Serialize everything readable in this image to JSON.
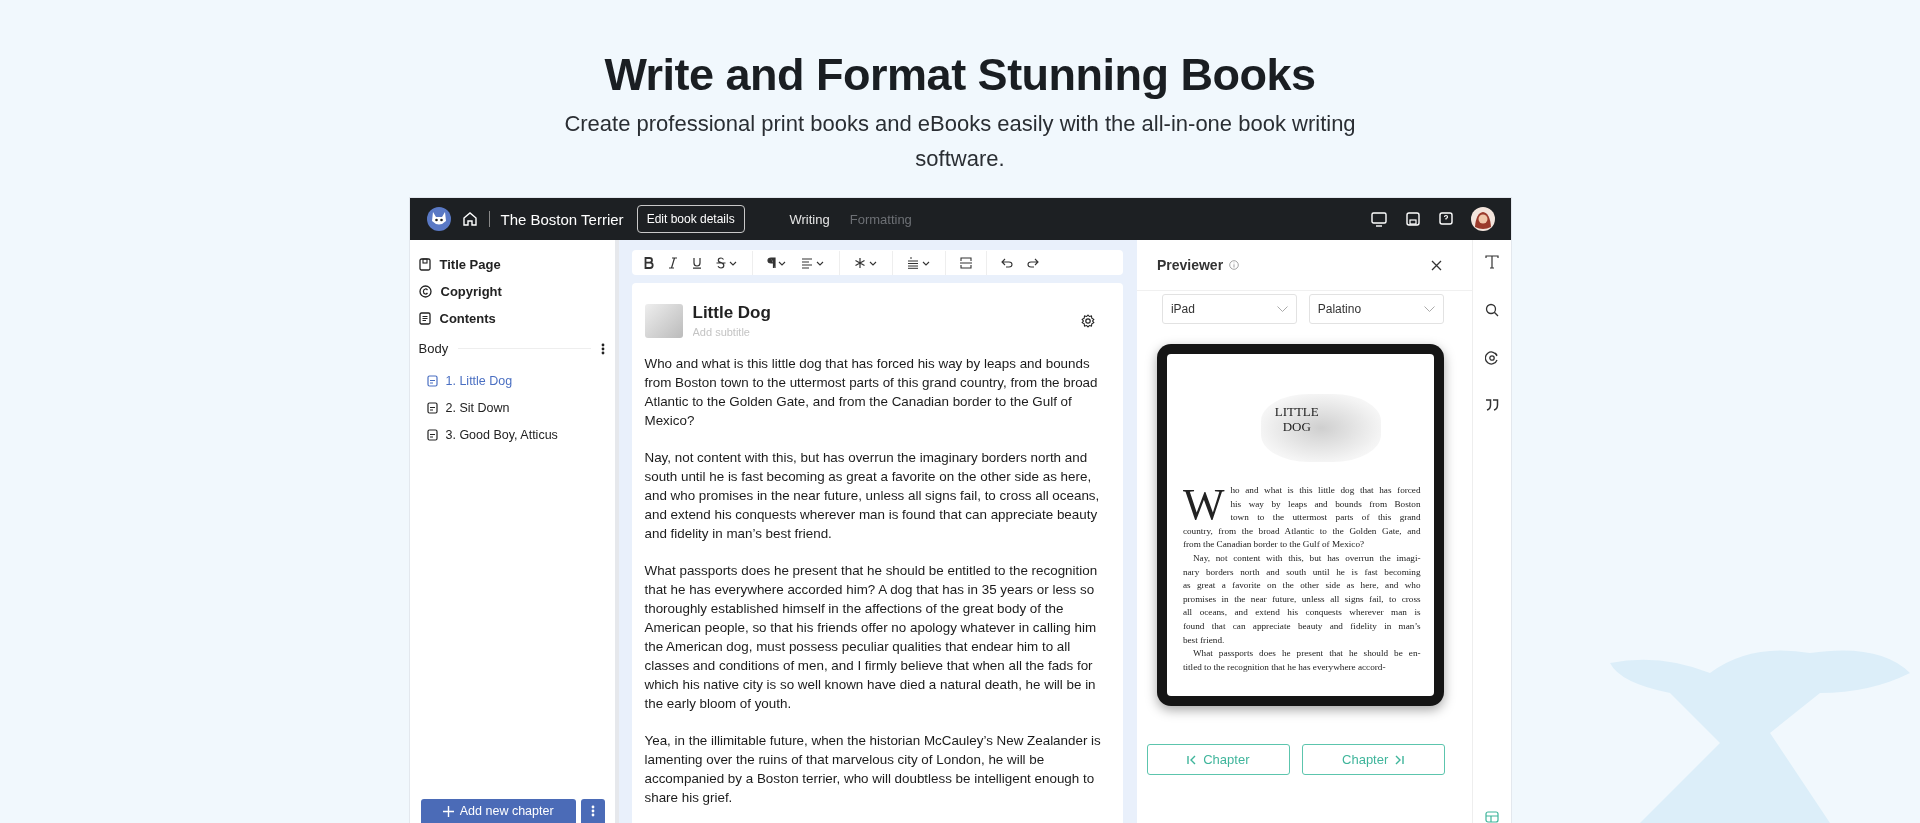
{
  "hero": {
    "title": "Write and Format Stunning Books",
    "subtitle": "Create professional print books and eBooks easily with the all-in-one book writing software."
  },
  "topbar": {
    "book_title": "The Boston Terrier",
    "edit_button": "Edit book details",
    "tabs": [
      {
        "label": "Writing",
        "selected": true
      },
      {
        "label": "Formatting",
        "selected": false
      }
    ]
  },
  "sidebar": {
    "front_matter": [
      {
        "label": "Title Page",
        "kind": "title"
      },
      {
        "label": "Copyright",
        "kind": "copyright"
      },
      {
        "label": "Contents",
        "kind": "contents"
      }
    ],
    "section": "Body",
    "chapters": [
      {
        "label": "1. Little Dog",
        "selected": true
      },
      {
        "label": "2. Sit Down",
        "selected": false
      },
      {
        "label": "3. Good Boy, Atticus",
        "selected": false
      }
    ],
    "add_button": "Add new chapter"
  },
  "editor": {
    "chapter_title": "Little Dog",
    "subtitle_placeholder": "Add subtitle",
    "paragraphs": [
      "Who and what is this little dog that has forced his way by leaps and bounds from Boston town to the uttermost parts of this grand country, from the broad Atlantic to the Golden Gate, and from the Canadian border to the Gulf of Mexico?",
      "Nay, not content with this, but has overrun the imaginary borders north and south until he is fast becoming as great a favorite on the other side as here, and who promises in the near future, unless all signs fail, to cross all oceans, and extend his conquests wherever man is found that can appreciate beauty and fidelity in man’s best friend.",
      "What passports does he present that he should be entitled to the recognition that he has everywhere accorded him? A dog that has in 35 years or less so thoroughly established himself in the affections of the great body of the American people, so that his friends offer no apology whatever in calling him the American dog, must possess peculiar qualities that endear him to all classes and conditions of men, and I firmly believe that when all the fads for which his native city is so well known have died a natural death, he will be in the early bloom of youth.",
      "Yea, in the illimitable future, when the historian McCauley’s New Zealander is lamenting over the ruins of that marvelous city of London, he will be accompanied by a Boston terrier, who will doubtless be intelligent enough to share his grief."
    ]
  },
  "previewer": {
    "title": "Previewer",
    "device": "iPad",
    "font": "Palatino",
    "page": {
      "title_lines": [
        "LITTLE",
        "DOG"
      ],
      "drop_cap": "W",
      "paragraphs": [
        [
          "ho and what is this little dog that has forced",
          "his way by leaps and bounds from Boston",
          "town to the uttermost parts of this grand",
          "country, from the broad Atlantic to the Golden Gate, and",
          "from the Canadian border to the Gulf of Mexico?"
        ],
        [
          "Nay, not content with this, but has overrun the imagi-",
          "nary borders north and south until he is fast becoming",
          "as great a favorite on the other side as here, and who",
          "promises in the near future, unless all signs fail, to cross",
          "all oceans, and extend his conquests wherever man is",
          "found that can appreciate beauty and fidelity in man’s",
          "best friend."
        ],
        [
          "What passports does he present that he should be en-",
          "titled to the recognition that he has everywhere accord-"
        ]
      ]
    },
    "prev_button": "Chapter",
    "next_button": "Chapter"
  }
}
